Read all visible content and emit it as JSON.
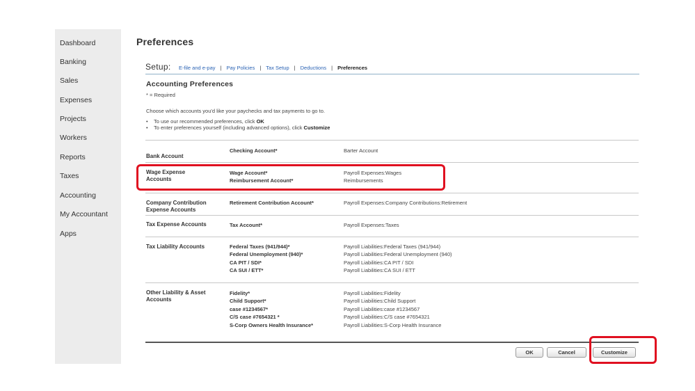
{
  "sidebar": {
    "items": [
      "Dashboard",
      "Banking",
      "Sales",
      "Expenses",
      "Projects",
      "Workers",
      "Reports",
      "Taxes",
      "Accounting",
      "My Accountant",
      "Apps"
    ]
  },
  "page": {
    "title": "Preferences"
  },
  "setup": {
    "label": "Setup:",
    "tabs": [
      "E-file and e-pay",
      "Pay Policies",
      "Tax Setup",
      "Deductions",
      "Preferences"
    ],
    "active_tab": "Preferences",
    "separator": "|"
  },
  "accounting": {
    "title": "Accounting Preferences",
    "required_note": "* = Required",
    "intro": "Choose which accounts you'd like your paychecks and tax payments to go to.",
    "bullet_1_text": "To use our recommended preferences, click ",
    "bullet_1_bold": "OK",
    "bullet_2_text": "To enter preferences yourself (including advanced options), click ",
    "bullet_2_bold": "Customize",
    "bullet_symbol": "•"
  },
  "groups": {
    "bank": {
      "label": "Bank Account",
      "fields": [
        "Checking Account*"
      ],
      "values": [
        "Barter Account"
      ]
    },
    "wage": {
      "label": "Wage Expense Accounts",
      "fields": [
        "Wage Account*",
        "Reimbursement Account*"
      ],
      "values": [
        "Payroll Expenses:Wages",
        "Reimbursements"
      ]
    },
    "company": {
      "label": "Company Contribution Expense Accounts",
      "fields": [
        "Retirement Contribution Account*"
      ],
      "values": [
        "Payroll Expenses:Company Contributions:Retirement"
      ]
    },
    "tax_expense": {
      "label": "Tax Expense Accounts",
      "fields": [
        "Tax Account*"
      ],
      "values": [
        "Payroll Expenses:Taxes"
      ]
    },
    "tax_liability": {
      "label": "Tax Liability Accounts",
      "fields": [
        "Federal Taxes (941/944)*",
        "Federal Unemployment (940)*",
        "CA PIT / SDI*",
        "CA SUI / ETT*"
      ],
      "values": [
        "Payroll Liabilities:Federal Taxes (941/944)",
        "Payroll Liabilities:Federal Unemployment (940)",
        "Payroll Liabilities:CA PIT / SDI",
        "Payroll Liabilities:CA SUI / ETT"
      ]
    },
    "other": {
      "label": "Other Liability & Asset Accounts",
      "fields": [
        "Fidelity*",
        "Child Support*",
        "case #1234567*",
        "C/S case #7654321 *",
        "S-Corp Owners Health Insurance*"
      ],
      "values": [
        "Payroll Liabilities:Fidelity",
        "Payroll Liabilities:Child Support",
        "Payroll Liabilities:case #1234567",
        "Payroll Liabilities:C/S case #7654321",
        "Payroll Liabilities:S-Corp Health Insurance"
      ]
    }
  },
  "buttons": {
    "ok": "OK",
    "cancel": "Cancel",
    "customize": "Customize"
  },
  "colors": {
    "highlight": "#e01020",
    "link": "#2b63b4",
    "sidebar_bg": "#ececec",
    "tab_underline": "#8fb1c8"
  }
}
